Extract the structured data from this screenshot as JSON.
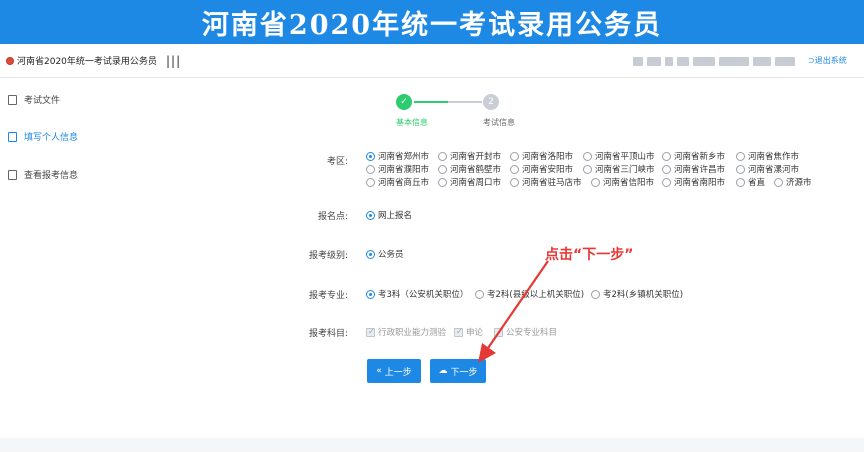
{
  "banner": {
    "title": "河南省2020年统一考试录用公务员"
  },
  "topbar": {
    "site_name": "河南省2020年统一考试录用公务员",
    "menu_icon": "|||",
    "logout_label": "退出系统"
  },
  "sidebar": {
    "items": [
      {
        "label": "考试文件"
      },
      {
        "label": "填写个人信息"
      },
      {
        "label": "查看报考信息"
      }
    ]
  },
  "steps": [
    {
      "label": "基本信息",
      "mark": "✓"
    },
    {
      "label": "考试信息",
      "mark": "2"
    }
  ],
  "form": {
    "exam_area": {
      "label": "考区:",
      "options": [
        "河南省郑州市",
        "河南省开封市",
        "河南省洛阳市",
        "河南省平顶山市",
        "河南省新乡市",
        "河南省焦作市",
        "河南省濮阳市",
        "河南省鹤壁市",
        "河南省安阳市",
        "河南省三门峡市",
        "河南省许昌市",
        "河南省漯河市",
        "河南省商丘市",
        "河南省周口市",
        "河南省驻马店市",
        "河南省信阳市",
        "河南省南阳市",
        "省直",
        "济源市"
      ],
      "selected": "河南省郑州市"
    },
    "registration_point": {
      "label": "报名点:",
      "value": "网上报名"
    },
    "level": {
      "label": "报考级别:",
      "value": "公务员"
    },
    "major": {
      "label": "报考专业:",
      "options": [
        "考3科（公安机关职位）",
        "考2科(县级以上机关职位)",
        "考2科(乡镇机关职位)"
      ],
      "selected": "考3科（公安机关职位）"
    },
    "subjects": {
      "label": "报考科目:",
      "items": [
        {
          "label": "行政职业能力测验",
          "checked": true
        },
        {
          "label": "申论",
          "checked": true
        },
        {
          "label": "公安专业科目",
          "checked": false
        }
      ]
    }
  },
  "buttons": {
    "prev": "上一步",
    "next": "下一步"
  },
  "annotation": {
    "text": "点击“下一步”",
    "color": "#e53935"
  },
  "colors": {
    "primary": "#1e88e5",
    "success": "#2ecc71"
  }
}
